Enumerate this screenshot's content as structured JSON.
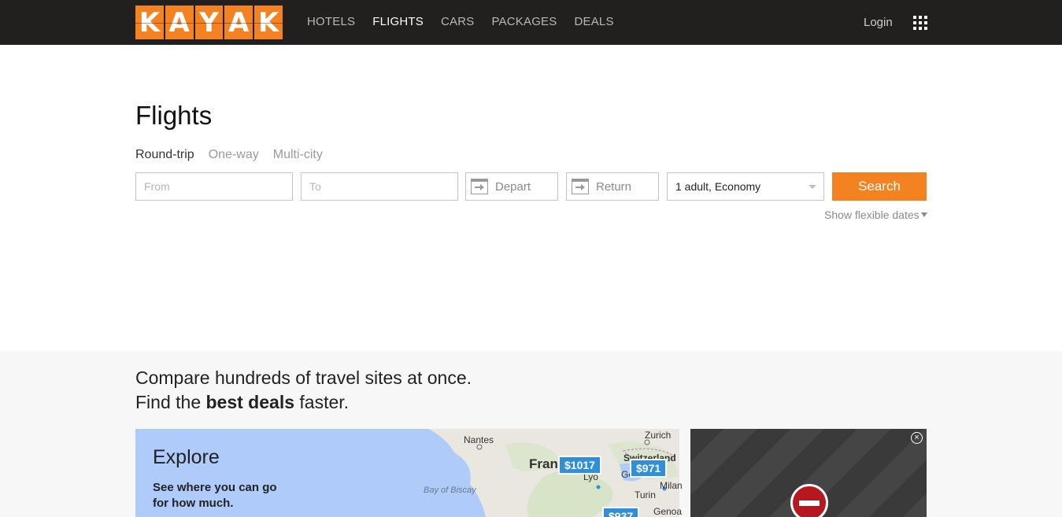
{
  "brand": {
    "logo_letters": [
      "K",
      "A",
      "Y",
      "A",
      "K"
    ],
    "accent_color": "#f58220",
    "topbar_color": "#221f1f"
  },
  "nav": {
    "items": [
      {
        "label": "HOTELS",
        "active": false
      },
      {
        "label": "FLIGHTS",
        "active": true
      },
      {
        "label": "CARS",
        "active": false
      },
      {
        "label": "PACKAGES",
        "active": false
      },
      {
        "label": "DEALS",
        "active": false
      }
    ],
    "login_label": "Login",
    "apps_icon": "grid-icon"
  },
  "search": {
    "title": "Flights",
    "trip_types": [
      {
        "label": "Round-trip",
        "active": true
      },
      {
        "label": "One-way",
        "active": false
      },
      {
        "label": "Multi-city",
        "active": false
      }
    ],
    "from_placeholder": "From",
    "to_placeholder": "To",
    "depart_label": "Depart",
    "return_label": "Return",
    "travelers_value": "1 adult, Economy",
    "search_label": "Search",
    "flexible_dates_label": "Show flexible dates"
  },
  "promo": {
    "line1": "Compare hundreds of travel sites at once.",
    "line2_prefix": "Find the ",
    "line2_bold": "best deals",
    "line2_suffix": " faster."
  },
  "explore": {
    "title": "Explore",
    "subtitle_line1": "See where you can go",
    "subtitle_line2": "for how much.",
    "map_labels": {
      "nantes": "Nantes",
      "bay": "Bay of Biscay",
      "france": "Fran",
      "lyon": "Lyo",
      "zurich": "Zurich",
      "switzerland": "Switzerland",
      "geneva": "Ge",
      "milan": "Milan",
      "turin": "Turin",
      "genoa": "Genoa"
    },
    "prices": [
      "$1017",
      "$971",
      "$937"
    ]
  },
  "ad": {
    "close_icon": "close-circle-icon",
    "blocked_icon": "no-entry-icon",
    "close_glyph": "×"
  }
}
